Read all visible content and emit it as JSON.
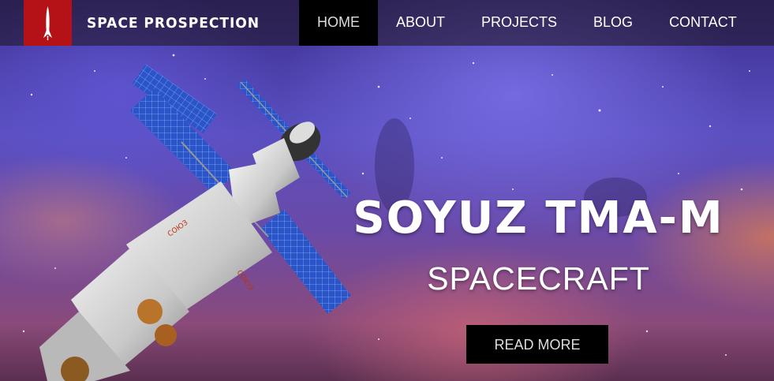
{
  "brand": {
    "name": "SPACE PROSPECTION",
    "logo_icon": "rocket-icon",
    "logo_color": "#b41217"
  },
  "nav": {
    "items": [
      {
        "label": "HOME",
        "active": true
      },
      {
        "label": "ABOUT",
        "active": false
      },
      {
        "label": "PROJECTS",
        "active": false
      },
      {
        "label": "BLOG",
        "active": false
      },
      {
        "label": "CONTACT",
        "active": false
      }
    ]
  },
  "hero": {
    "title": "SOYUZ TMA-M",
    "subtitle": "SPACECRAFT",
    "cta_label": "READ MORE",
    "image": "spacecraft-illustration"
  }
}
